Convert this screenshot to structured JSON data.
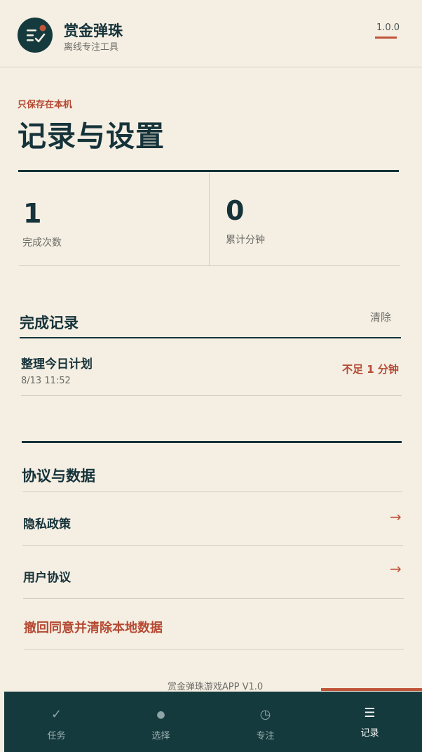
{
  "header": {
    "app_title": "赏金弹珠",
    "app_subtitle": "离线专注工具",
    "version": "1.0.0"
  },
  "page": {
    "kicker": "只保存在本机",
    "title": "记录与设置"
  },
  "stats": [
    {
      "value": "1",
      "label": "完成次数"
    },
    {
      "value": "0",
      "label": "累计分钟"
    }
  ],
  "records": {
    "title": "完成记录",
    "clear_label": "清除",
    "items": [
      {
        "title": "整理今日计划",
        "time": "8/13 11:52",
        "status": "不足 1 分钟"
      }
    ]
  },
  "agreements": {
    "title": "协议与数据",
    "privacy_label": "隐私政策",
    "terms_label": "用户协议",
    "arrow": "→",
    "revoke_label": "撤回同意并清除本地数据"
  },
  "footer": {
    "note": "赏金弹珠游戏APP V1.0"
  },
  "tabs": [
    {
      "label": "任务",
      "icon": "check-icon",
      "glyph": "✓"
    },
    {
      "label": "选择",
      "icon": "dot-icon",
      "glyph": "●"
    },
    {
      "label": "专注",
      "icon": "clock-icon",
      "glyph": "◷"
    },
    {
      "label": "记录",
      "icon": "list-icon",
      "glyph": "☰",
      "active": true
    }
  ],
  "colors": {
    "background": "#f5efe3",
    "primary": "#16333a",
    "accent": "#c0553a",
    "tabbar": "#153a3e"
  }
}
